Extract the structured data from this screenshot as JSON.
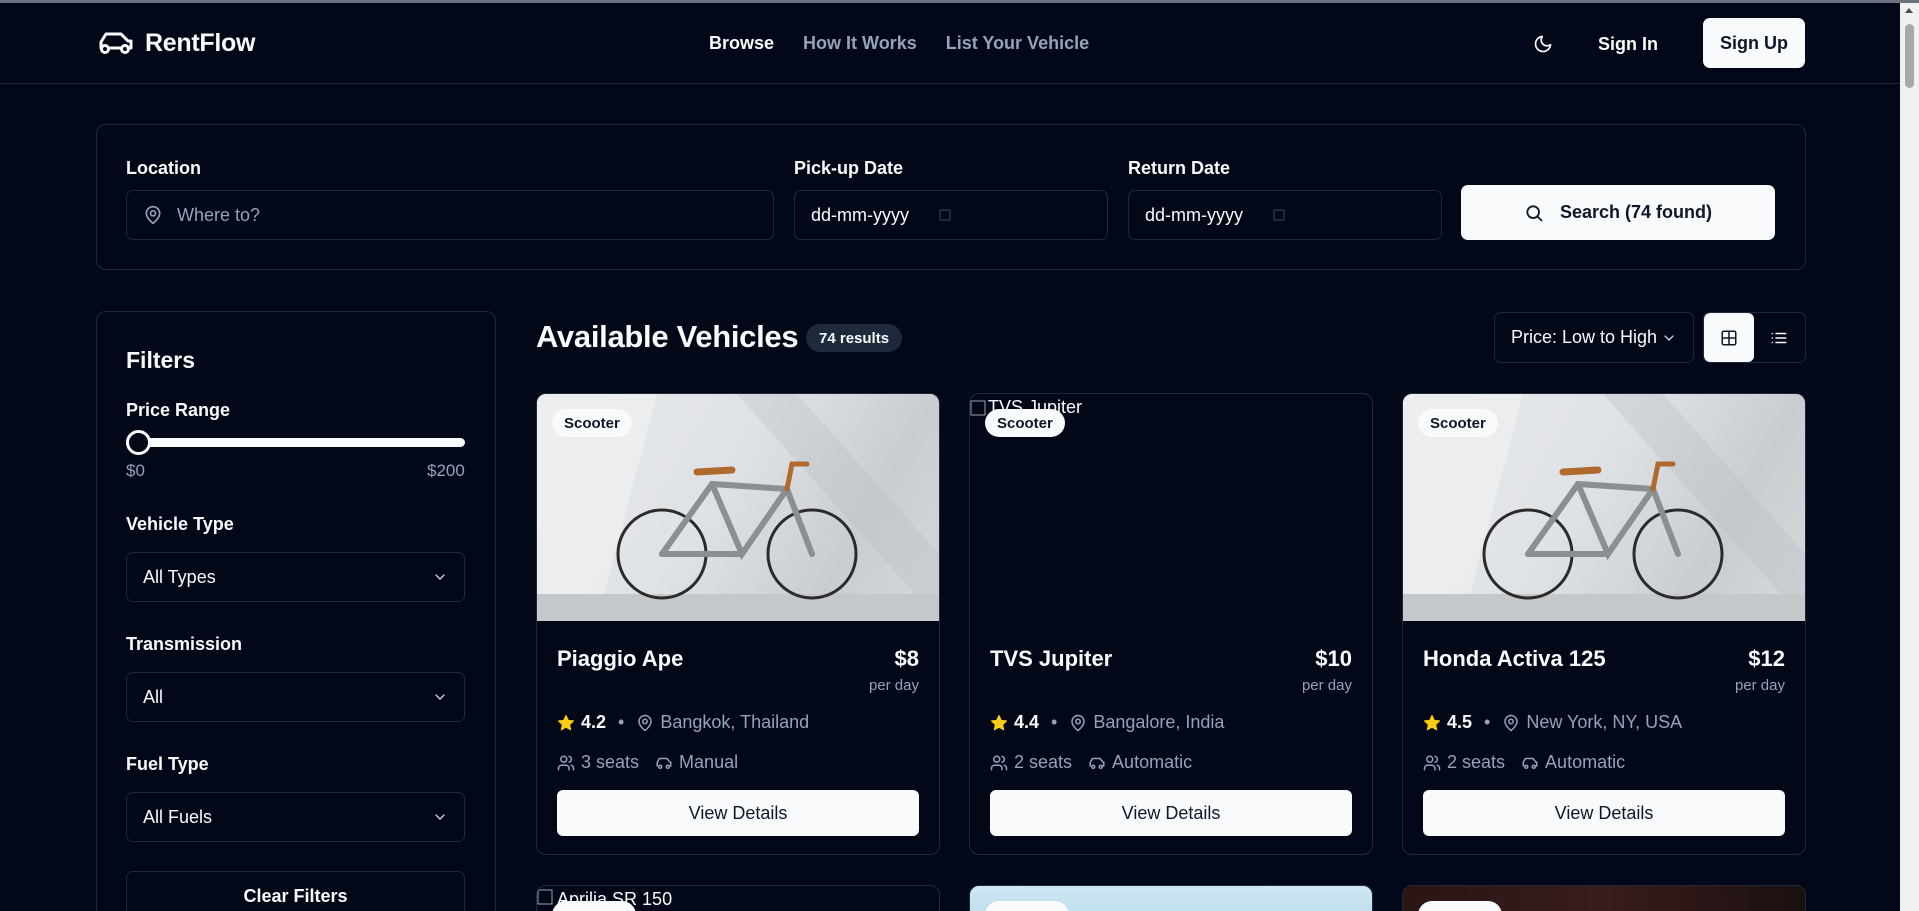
{
  "app": {
    "name": "RentFlow"
  },
  "nav": {
    "browse": "Browse",
    "how": "How It Works",
    "list": "List Your Vehicle"
  },
  "auth": {
    "sign_in": "Sign In",
    "sign_up": "Sign Up"
  },
  "search": {
    "location_label": "Location",
    "location_placeholder": "Where to?",
    "pickup_label": "Pick-up Date",
    "pickup_value": "dd-mm-yyyy",
    "return_label": "Return Date",
    "return_value": "dd-mm-yyyy",
    "button": "Search (74 found)"
  },
  "filters": {
    "title": "Filters",
    "price_label": "Price Range",
    "price_min": "$0",
    "price_max": "$200",
    "price_slider_value": 0,
    "type_label": "Vehicle Type",
    "type_value": "All Types",
    "transmission_label": "Transmission",
    "transmission_value": "All",
    "fuel_label": "Fuel Type",
    "fuel_value": "All Fuels",
    "clear": "Clear Filters"
  },
  "results": {
    "title": "Available Vehicles",
    "count": "74 results",
    "sort": "Price: Low to High"
  },
  "cards": [
    {
      "badge": "Scooter",
      "name": "Piaggio Ape",
      "price": "$8",
      "per": "per day",
      "rating": "4.2",
      "location": "Bangkok, Thailand",
      "seats": "3 seats",
      "transmission": "Manual",
      "button": "View Details"
    },
    {
      "badge": "Scooter",
      "name": "TVS Jupiter",
      "price": "$10",
      "per": "per day",
      "rating": "4.4",
      "location": "Bangalore, India",
      "seats": "2 seats",
      "transmission": "Automatic",
      "button": "View Details",
      "alt": "TVS Jupiter"
    },
    {
      "badge": "Scooter",
      "name": "Honda Activa 125",
      "price": "$12",
      "per": "per day",
      "rating": "4.5",
      "location": "New York, NY, USA",
      "seats": "2 seats",
      "transmission": "Automatic",
      "button": "View Details"
    }
  ],
  "row2": {
    "alt1": "Aprilia SR 150"
  },
  "colors": {
    "background": "#020817",
    "border": "#1e293b",
    "text": "#f8fafc",
    "muted": "#94a3b8",
    "star": "#facc15"
  }
}
